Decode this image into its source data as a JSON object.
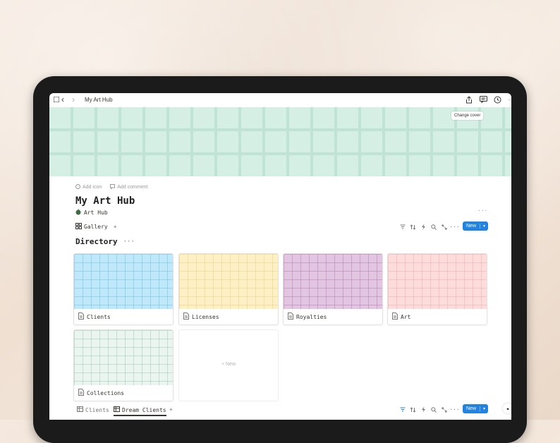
{
  "breadcrumb": {
    "title": "My Art Hub"
  },
  "cover": {
    "change_label": "Change cover",
    "color": "#d6efe5"
  },
  "meta": {
    "add_icon": "Add icon",
    "add_comment": "Add comment"
  },
  "page": {
    "title": "My Art Hub",
    "subtitle": "Art Hub",
    "more": "···"
  },
  "view": {
    "tab_label": "Gallery",
    "add": "+",
    "new_label": "New",
    "more": "···"
  },
  "section": {
    "title": "Directory",
    "more": "···"
  },
  "cards": [
    {
      "label": "Clients",
      "color": "#bfe9fb"
    },
    {
      "label": "Licenses",
      "color": "#fdf0c4"
    },
    {
      "label": "Royalties",
      "color": "#e2c5e1"
    },
    {
      "label": "Art",
      "color": "#fddcdc"
    },
    {
      "label": "Collections",
      "color": "#e9f5ee"
    }
  ],
  "new_card": {
    "label": "+ New"
  },
  "bottom": {
    "tabs": [
      {
        "label": "Clients"
      },
      {
        "label": "Dream Clients"
      }
    ],
    "add": "+",
    "new_label": "New"
  }
}
